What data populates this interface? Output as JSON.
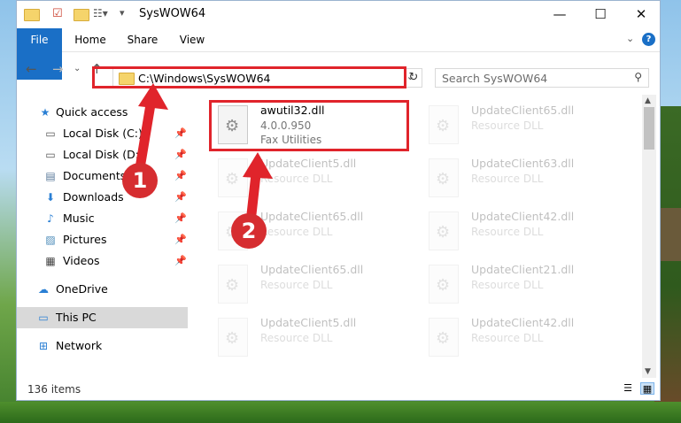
{
  "window": {
    "title": "SysWOW64"
  },
  "ribbon": {
    "tabs": [
      "File",
      "Home",
      "Share",
      "View"
    ],
    "help": "?"
  },
  "address": {
    "path": "C:\\Windows\\SysWOW64"
  },
  "search": {
    "placeholder": "Search SysWOW64"
  },
  "sidebar": {
    "items": [
      {
        "label": "Quick access",
        "icon": "star-icon",
        "pinned": false
      },
      {
        "label": "Local Disk (C:)",
        "icon": "drive-icon",
        "pinned": true
      },
      {
        "label": "Local Disk (D:)",
        "icon": "drive-icon",
        "pinned": true
      },
      {
        "label": "Documents",
        "icon": "documents-icon",
        "pinned": true
      },
      {
        "label": "Downloads",
        "icon": "download-icon",
        "pinned": true
      },
      {
        "label": "Music",
        "icon": "music-icon",
        "pinned": true
      },
      {
        "label": "Pictures",
        "icon": "pictures-icon",
        "pinned": true
      },
      {
        "label": "Videos",
        "icon": "videos-icon",
        "pinned": true
      },
      {
        "label": "OneDrive",
        "icon": "cloud-icon",
        "pinned": false
      },
      {
        "label": "This PC",
        "icon": "computer-icon",
        "pinned": false,
        "selected": true
      },
      {
        "label": "Network",
        "icon": "network-icon",
        "pinned": false
      }
    ]
  },
  "files": [
    {
      "name": "awutil32.dll",
      "version": "4.0.0.950",
      "description": "Fax Utilities",
      "highlighted": true
    },
    {
      "name": "UpdateClient65.dll",
      "description": "Resource DLL"
    },
    {
      "name": "UpdateClient5.dll",
      "description": "Resource DLL"
    },
    {
      "name": "UpdateClient63.dll",
      "description": "Resource DLL"
    },
    {
      "name": "UpdateClient65.dll",
      "description": "Resource DLL"
    },
    {
      "name": "UpdateClient42.dll",
      "description": "Resource DLL"
    },
    {
      "name": "UpdateClient65.dll",
      "description": "Resource DLL"
    },
    {
      "name": "UpdateClient21.dll",
      "description": "Resource DLL"
    },
    {
      "name": "UpdateClient5.dll",
      "description": "Resource DLL"
    },
    {
      "name": "UpdateClient42.dll",
      "description": "Resource DLL"
    }
  ],
  "status": {
    "item_count": "136 items"
  },
  "annotations": {
    "step1": "1",
    "step2": "2"
  },
  "colors": {
    "accent": "#1a6fc6",
    "highlight_red": "#e0242b",
    "badge_red": "#d62d30"
  }
}
